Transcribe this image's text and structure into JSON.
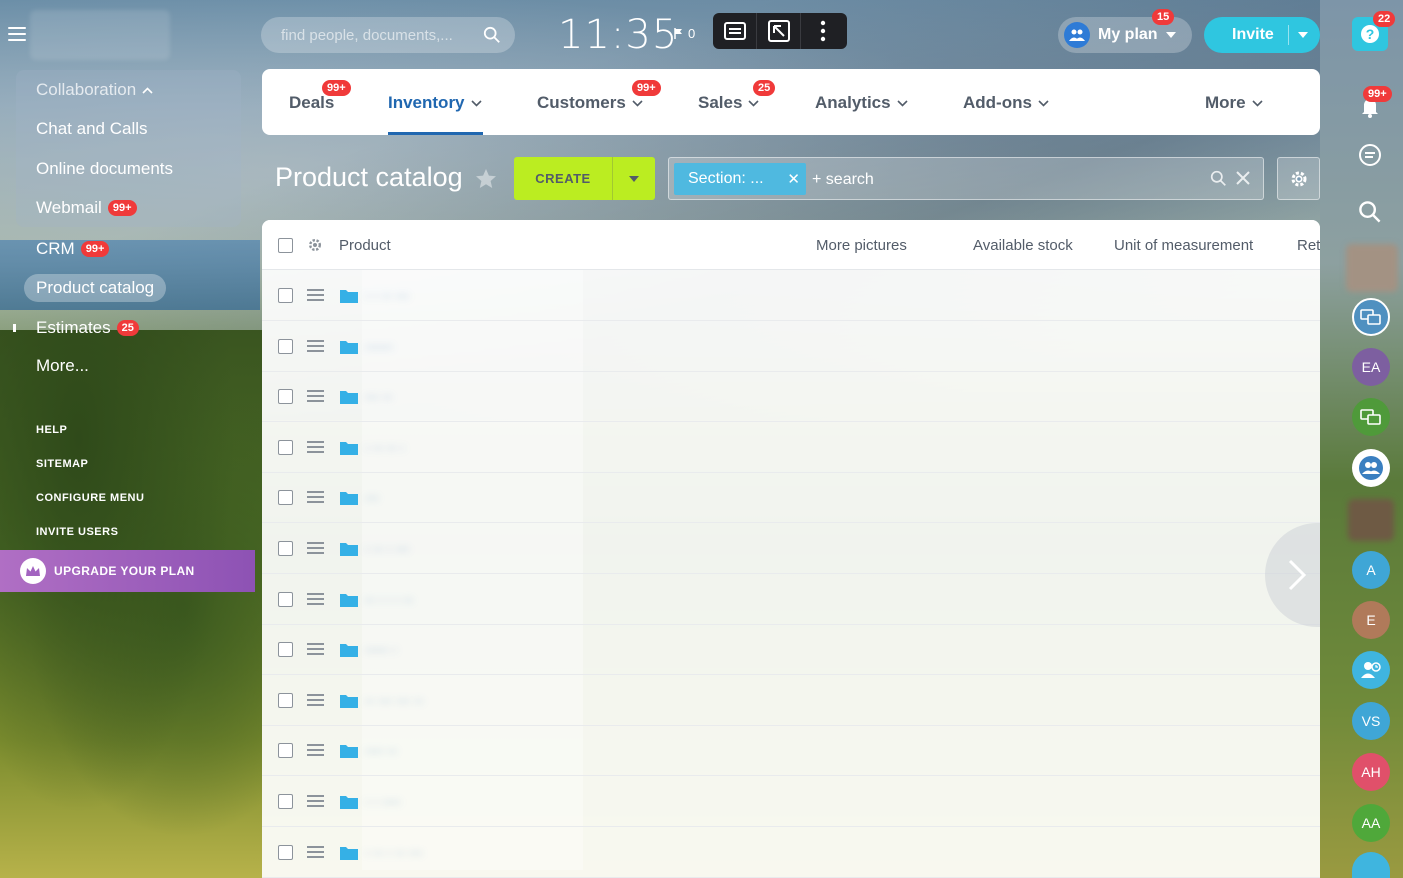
{
  "header": {
    "search_placeholder": "find people, documents,...",
    "clock": "11:35",
    "flag_count": "0",
    "plan_label": "My plan",
    "plan_badge": "15",
    "invite_label": "Invite",
    "help_badge": "22"
  },
  "sidebar": {
    "group_label": "Collaboration",
    "items": [
      {
        "label": "Chat and Calls"
      },
      {
        "label": "Online documents"
      },
      {
        "label": "Webmail",
        "badge": "99+"
      },
      {
        "label": "CRM",
        "badge": "99+"
      },
      {
        "label": "Product catalog"
      },
      {
        "label": "Estimates",
        "badge": "25"
      },
      {
        "label": "More..."
      }
    ],
    "links": [
      "HELP",
      "SITEMAP",
      "CONFIGURE MENU",
      "INVITE USERS"
    ],
    "upgrade_label": "UPGRADE YOUR PLAN"
  },
  "tabs": [
    {
      "label": "Deals",
      "badge": "99+"
    },
    {
      "label": "Inventory"
    },
    {
      "label": "Customers",
      "badge": "99+"
    },
    {
      "label": "Sales",
      "badge": "25"
    },
    {
      "label": "Analytics"
    },
    {
      "label": "Add-ons"
    },
    {
      "label": "More"
    }
  ],
  "toolbar": {
    "page_title": "Product catalog",
    "create_label": "CREATE",
    "filter_tag": "Section: ...",
    "filter_search": "+ search"
  },
  "grid": {
    "columns": [
      "Product",
      "More pictures",
      "Available stock",
      "Unit of measurement",
      "Ret"
    ],
    "rows": [
      "· · ·· ···",
      "······",
      "··· ··",
      "· ·· ·· ·",
      "···",
      "· ·· · ···",
      "·· · · · ··",
      "····· ·",
      "·· ··· ··· ··",
      "···· ··",
      "· · ····",
      "· ·· · ·· ···"
    ]
  },
  "rail": {
    "notif_badge": "99+",
    "avatars": [
      "EA",
      "A",
      "E",
      "VS",
      "AH",
      "AA"
    ]
  },
  "colors": {
    "accent": "#2067b0",
    "create": "#bbed21",
    "invite": "#2fc6e0",
    "badge": "#f03a3a",
    "filter_tag": "#4fb9e0"
  }
}
